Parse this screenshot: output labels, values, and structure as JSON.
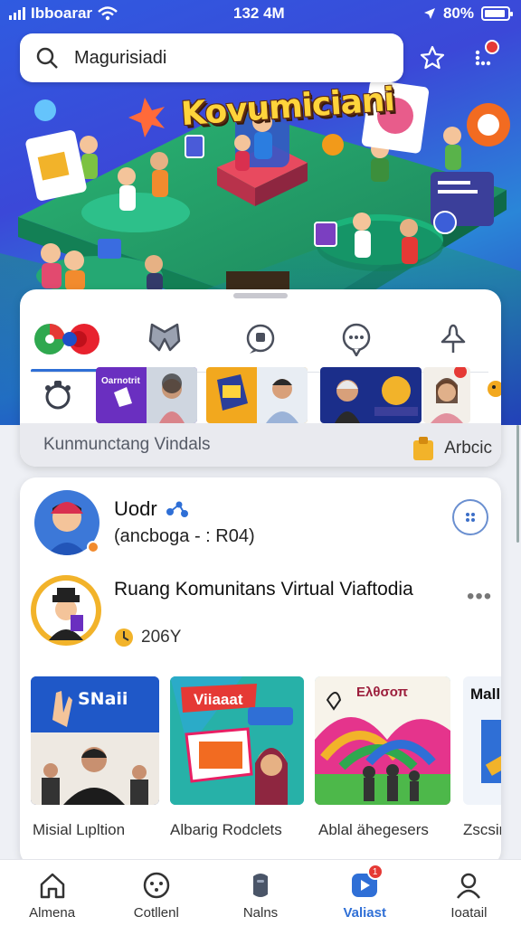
{
  "status_bar": {
    "carrier": "Ibboarar",
    "time": "132 4M",
    "battery": "80%"
  },
  "search": {
    "placeholder": "Magurisiadi"
  },
  "hero": {
    "title": "Kovumiciani"
  },
  "tabs": [
    {
      "icon": "multicolor-circles-icon",
      "active": true
    },
    {
      "icon": "butterfly-icon",
      "active": false
    },
    {
      "icon": "chat-bubble-icon",
      "active": false
    },
    {
      "icon": "message-dots-icon",
      "active": false
    },
    {
      "icon": "pin-icon",
      "active": false
    }
  ],
  "stories": {
    "first_card_label": "Oarnotrit"
  },
  "community_bar": {
    "label": "Kunmunctang Vindals",
    "right_label": "Arbcic"
  },
  "user": {
    "name": "Uodr",
    "subtitle": "(ancboga - : R04)"
  },
  "post": {
    "title": "Ruang Komunitans Virtual Viaftodia",
    "meta": "206Y",
    "more": "•••"
  },
  "thumbnails": [
    {
      "caption": "Misial Lιpltion",
      "overlay": "SNaii"
    },
    {
      "caption": "Albarig Rodclets",
      "overlay": "Viiaaat"
    },
    {
      "caption": "Ablal ähegesers",
      "overlay": "Eλθσοπ"
    },
    {
      "caption": "Zscsir",
      "overlay": "Mall"
    }
  ],
  "bottom_nav": [
    {
      "label": "Almena",
      "icon": "home-icon",
      "active": false
    },
    {
      "label": "Cotllenl",
      "icon": "face-icon",
      "active": false
    },
    {
      "label": "Nalns",
      "icon": "phone-icon",
      "active": false
    },
    {
      "label": "Valiast",
      "icon": "play-badge-icon",
      "active": true,
      "badge": "1"
    },
    {
      "label": "Ioatail",
      "icon": "profile-icon",
      "active": false
    }
  ],
  "colors": {
    "accent": "#2f6fd6",
    "hero_top": "#2f5be0",
    "badge": "#e53935",
    "title_yellow": "#ffd43b"
  }
}
